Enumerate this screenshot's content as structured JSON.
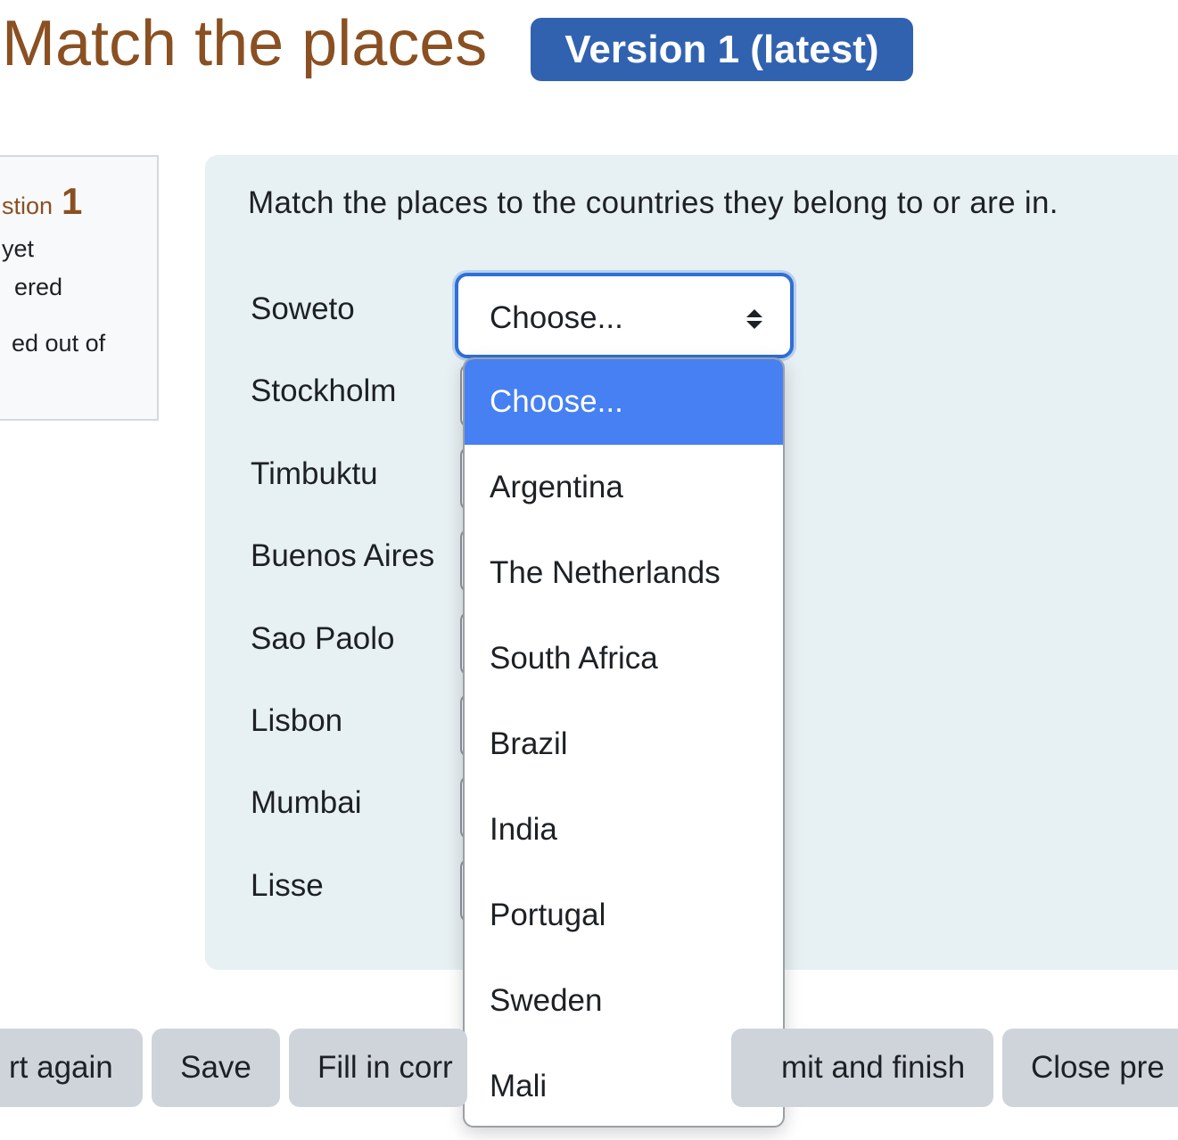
{
  "header": {
    "title": "Match the places",
    "version_badge": "Version 1 (latest)"
  },
  "info": {
    "question_word": "stion",
    "question_number": "1",
    "line1": "yet",
    "line2": "ered",
    "line3": "ed out of"
  },
  "question": {
    "text": "Match the places to the countries they belong to or are in.",
    "rows": [
      {
        "label": "Soweto"
      },
      {
        "label": "Stockholm"
      },
      {
        "label": "Timbuktu"
      },
      {
        "label": "Buenos Aires"
      },
      {
        "label": "Sao Paolo"
      },
      {
        "label": "Lisbon"
      },
      {
        "label": "Mumbai"
      },
      {
        "label": "Lisse"
      }
    ],
    "active_select_value": "Choose...",
    "options": [
      "Choose...",
      "Argentina",
      "The Netherlands",
      "South Africa",
      "Brazil",
      "India",
      "Portugal",
      "Sweden",
      "Mali"
    ],
    "highlighted_option": "Choose..."
  },
  "buttons": {
    "start_again": "rt again",
    "save": "Save",
    "fill_correct": "Fill in corr",
    "submit_finish": "mit and finish",
    "close_preview": "Close pre"
  },
  "colors": {
    "title": "#8a5022",
    "badge": "#3162b0",
    "highlight": "#4680f2",
    "panel": "#e7f0f3"
  },
  "icons": {
    "select_arrow": "sort-updown-icon"
  }
}
